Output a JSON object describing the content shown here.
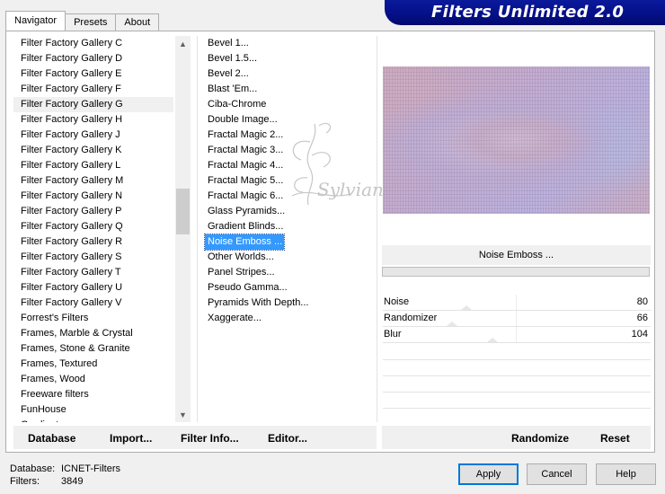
{
  "tabs": [
    "Navigator",
    "Presets",
    "About"
  ],
  "banner": {
    "title": "Filters Unlimited 2.0"
  },
  "categories": [
    "Filter Factory Gallery C",
    "Filter Factory Gallery D",
    "Filter Factory Gallery E",
    "Filter Factory Gallery F",
    "Filter Factory Gallery G",
    "Filter Factory Gallery H",
    "Filter Factory Gallery J",
    "Filter Factory Gallery K",
    "Filter Factory Gallery L",
    "Filter Factory Gallery M",
    "Filter Factory Gallery N",
    "Filter Factory Gallery P",
    "Filter Factory Gallery Q",
    "Filter Factory Gallery R",
    "Filter Factory Gallery S",
    "Filter Factory Gallery T",
    "Filter Factory Gallery U",
    "Filter Factory Gallery V",
    "Forrest's Filters",
    "Frames, Marble & Crystal",
    "Frames, Stone & Granite",
    "Frames, Textured",
    "Frames, Wood",
    "Freeware filters",
    "FunHouse",
    "Gradient"
  ],
  "selected_category": "Filter Factory Gallery G",
  "filters": [
    "Bevel 1...",
    "Bevel 1.5...",
    "Bevel 2...",
    "Blast 'Em...",
    "Ciba-Chrome",
    "Double Image...",
    "Fractal Magic 2...",
    "Fractal Magic 3...",
    "Fractal Magic 4...",
    "Fractal Magic 5...",
    "Fractal Magic 6...",
    "Glass Pyramids...",
    "Gradient Blinds...",
    "Noise Emboss ...",
    "Other Worlds...",
    "Panel Stripes...",
    "Pseudo Gamma...",
    "Pyramids With Depth...",
    "Xaggerate..."
  ],
  "selected_filter": "Noise Emboss ...",
  "watermark": {
    "text": "Sylviane"
  },
  "filter_title": "Noise Emboss ...",
  "sliders": [
    {
      "label": "Noise",
      "value": "80",
      "level": 80
    },
    {
      "label": "Randomizer",
      "value": "66",
      "level": 66
    },
    {
      "label": "Blur",
      "value": "104",
      "level": 104
    }
  ],
  "left_buttons": [
    "Database",
    "Import...",
    "Filter Info...",
    "Editor..."
  ],
  "right_buttons": [
    "Randomize",
    "Reset"
  ],
  "status": {
    "database_label": "Database:",
    "database_value": "ICNET-Filters",
    "filters_label": "Filters:",
    "filters_value": "3849"
  },
  "dialog_buttons": [
    "Apply",
    "Cancel",
    "Help"
  ],
  "colors": {
    "banner": "#050f86",
    "selection": "#3399ff",
    "default_button_border": "#0078d7"
  }
}
